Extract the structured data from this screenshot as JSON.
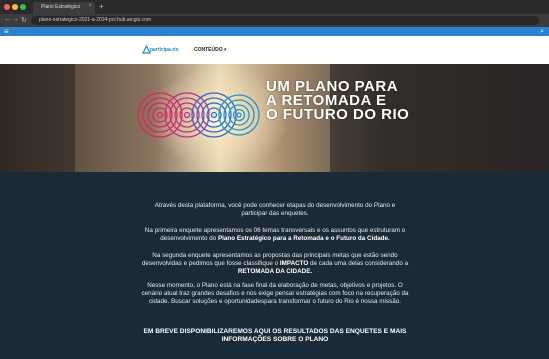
{
  "browser": {
    "tab_title": "Plano Estratégico",
    "tab_close": "×",
    "new_tab": "+",
    "back": "←",
    "forward": "→",
    "reload": "↻",
    "url": "plano-estrategico-2021-a-2024-pcr.hub.arcgis.com"
  },
  "topbar": {
    "menu_icon": "≡",
    "search_icon": "⌕",
    "accent": "#2d7fd0"
  },
  "header": {
    "logo_text": "participa.rio",
    "menu_label": "CONTEÚDO ▾"
  },
  "side_buttons": [
    "☆",
    "⇤"
  ],
  "hero": {
    "title_lines": [
      "UM PLANO PARA",
      "A RETOMADA E",
      "O FUTURO DO RIO"
    ],
    "circle_colors": [
      "#e0245e",
      "#c0318a",
      "#2f6ad3",
      "#1a97d6"
    ]
  },
  "content": {
    "p1_line1": "Através desta plataforma, você pode conhecer etapas do desenvolvimento do Plano e",
    "p1_line2": "participar das enquetes.",
    "p2_line1": "Na primeira enquete apresentamos os 06 temas transversais e os assuntos que estruturam o",
    "p2_line2_pre": "desenvolvimento do ",
    "p2_line2_bold": "Plano Estratégico para a Retomada e o Futuro da Cidade.",
    "p3_line1": "Na segunda enquete apresentamos as propostas das principais metas que estão sendo",
    "p3_line2_pre": "desenvolvidas e pedimos que fosse classifique o ",
    "p3_line2_bold": "IMPACTO",
    "p3_line2_post": " de cada uma delas considerando a",
    "p3_line3_bold": "RETOMADA DA CIDADE.",
    "p4_line1": "Nesse momento, o Plano está na fase final da elaboração de metas, objetivos e projetos. O",
    "p4_line2": "cenário atual traz grandes desafios e nos exige pensar estratégias com foco na recuperação da",
    "p4_line3": "cidade. Buscar soluções e oportunidadespara transformar o futuro do Rio é nossa missão.",
    "closing_line1": "EM BREVE DISPONIBILIZAREMOS AQUI OS RESULTADOS DAS ENQUETES E MAIS",
    "closing_line2": "INFORMAÇÕES SOBRE O PLANO"
  }
}
